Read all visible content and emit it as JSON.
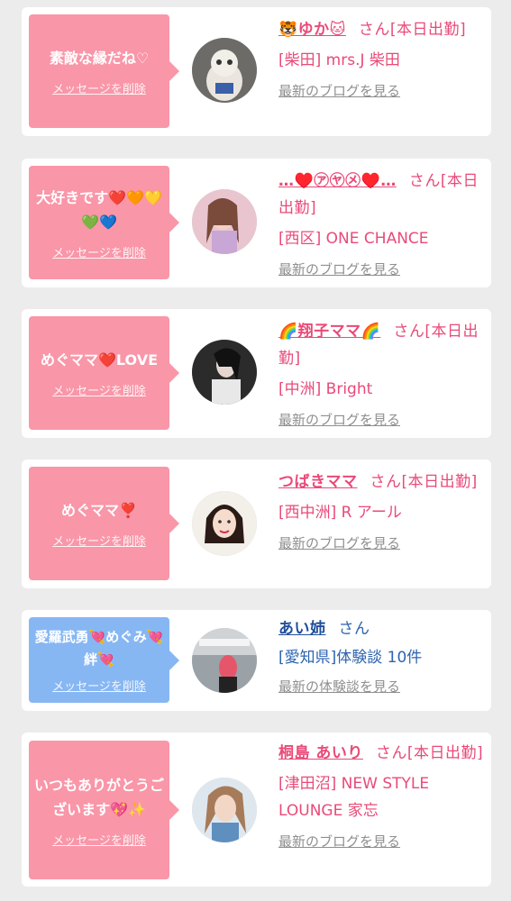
{
  "delete_label": "メッセージを削除",
  "items": [
    {
      "message": "素敵な縁だね♡",
      "username": "🐯ゆか🐱",
      "san": "さん",
      "status": "[本日出勤]",
      "shop": "[柴田] mrs.J 柴田",
      "blog": "最新のブログを見る",
      "theme": "pink"
    },
    {
      "message": "大好きです❤️🧡💛💚💙",
      "username": "…♥️㋐㋳㋱♥️…",
      "san": "さん",
      "status": "[本日出勤]",
      "shop": "[西区] ONE CHANCE",
      "blog": "最新のブログを見る",
      "theme": "pink"
    },
    {
      "message": "めぐママ❤️LOVE",
      "username": "🌈翔子ママ🌈",
      "san": "さん",
      "status": "[本日出勤]",
      "shop": "[中洲] Bright",
      "blog": "最新のブログを見る",
      "theme": "pink"
    },
    {
      "message": "めぐママ❣️",
      "username": "つばきママ",
      "san": "さん",
      "status": "[本日出勤]",
      "shop": "[西中洲] R アール",
      "blog": "最新のブログを見る",
      "theme": "pink"
    },
    {
      "message": "愛羅武勇💘めぐみ💘絆💘",
      "username": "あい姉",
      "san": "さん",
      "status": "",
      "shop": "[愛知県]体験談 10件",
      "blog": "最新の体験談を見る",
      "theme": "blue"
    },
    {
      "message": "いつもありがとうございます💖✨",
      "username": "桐島 あいり",
      "san": "さん",
      "status": "[本日出勤]",
      "shop": "[津田沼] NEW STYLE LOUNGE 家忘",
      "blog": "最新のブログを見る",
      "theme": "pink"
    }
  ],
  "colors": {
    "pink_bubble": "#f996a8",
    "blue_bubble": "#87b7f3",
    "pink_text": "#e94a78",
    "blue_text": "#2d64b0",
    "link_gray": "#8f8f8f",
    "page_bg": "#ececec"
  },
  "avatar_icons": [
    "cat-figure-avatar",
    "woman-avatar",
    "woman-avatar",
    "woman-avatar",
    "person-avatar",
    "woman-avatar"
  ]
}
